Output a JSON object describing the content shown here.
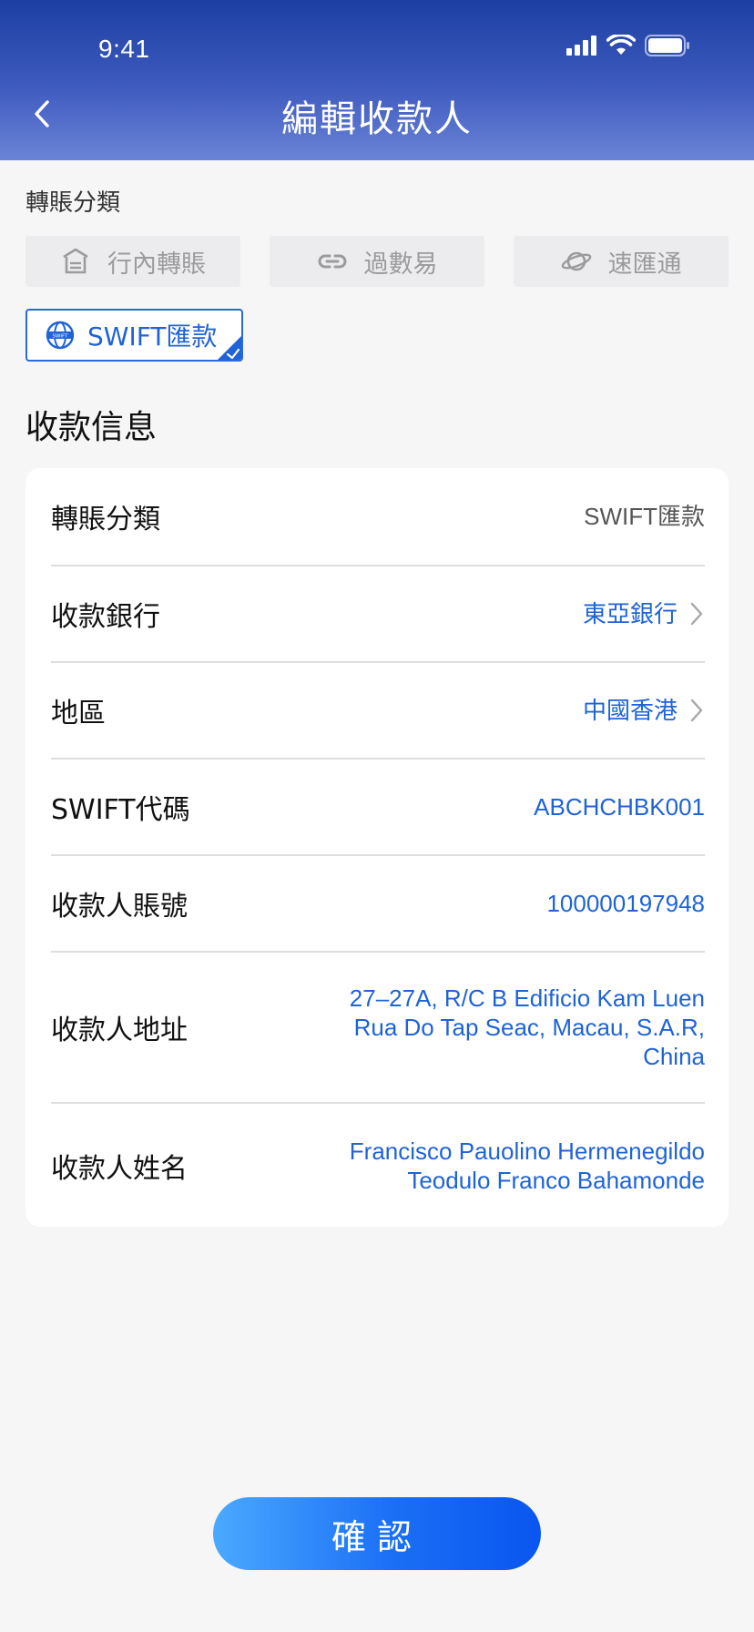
{
  "status_bar": {
    "time": "9:41"
  },
  "header": {
    "title": "編輯收款人"
  },
  "transfer_category": {
    "label": "轉賬分類",
    "options": [
      {
        "label": "行內轉賬",
        "icon": "bank-icon"
      },
      {
        "label": "過數易",
        "icon": "link-icon"
      },
      {
        "label": "速匯通",
        "icon": "planet-icon"
      }
    ],
    "selected": {
      "label": "SWIFT匯款",
      "icon": "swift-globe-icon",
      "badge": "SWIFT"
    }
  },
  "payee_info": {
    "title": "收款信息",
    "rows": [
      {
        "label": "轉賬分類",
        "value": "SWIFT匯款"
      },
      {
        "label": "收款銀行",
        "value": "東亞銀行"
      },
      {
        "label": "地區",
        "value": "中國香港"
      },
      {
        "label": "SWIFT代碼",
        "value": "ABCHCHBK001"
      },
      {
        "label": "收款人賬號",
        "value": "100000197948"
      },
      {
        "label": "收款人地址",
        "value_lines": [
          "27–27A, R/C B Edificio Kam Luen",
          "Rua Do Tap Seac, Macau, S.A.R,",
          "China"
        ]
      },
      {
        "label": "收款人姓名",
        "value_lines": [
          "Francisco Pauolino Hermenegildo",
          "Teodulo Franco Bahamonde"
        ]
      }
    ]
  },
  "confirm_button": {
    "label": "確認"
  },
  "colors": {
    "accent": "#1f63d6",
    "header_start": "#1c3fa3",
    "header_end": "#6a84d6",
    "button_start": "#4aa9ff",
    "button_end": "#0a55f0"
  }
}
